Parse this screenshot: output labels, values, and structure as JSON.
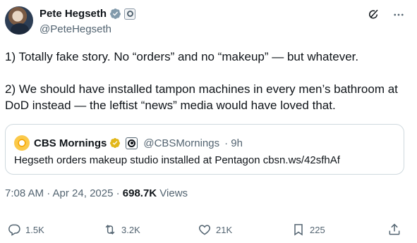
{
  "author": {
    "name": "Pete Hegseth",
    "handle": "@PeteHegseth",
    "badge_color": "#1d9bf0"
  },
  "tweet": {
    "paragraph1": "1) Totally fake story. No “orders” and no “makeup” — but whatever.",
    "paragraph2": "2) We should have installed tampon machines in every men’s bathroom at DoD instead — the leftist “news” media would have loved that."
  },
  "quoted": {
    "name": "CBS Mornings",
    "handle": "@CBSMornings",
    "time": "· 9h",
    "text": "Hegseth orders makeup studio installed at Pentagon cbsn.ws/42sfhAf",
    "badge_color": "#e2b719"
  },
  "meta": {
    "timestamp": "7:08 AM · Apr 24, 2025 · ",
    "views_count": "698.7K",
    "views_label": " Views"
  },
  "actions": {
    "replies": "1.5K",
    "reposts": "3.2K",
    "likes": "21K",
    "bookmarks": "225"
  },
  "icons": [
    "grok-icon",
    "more-icon",
    "reply-icon",
    "repost-icon",
    "like-icon",
    "bookmark-icon",
    "share-icon"
  ]
}
